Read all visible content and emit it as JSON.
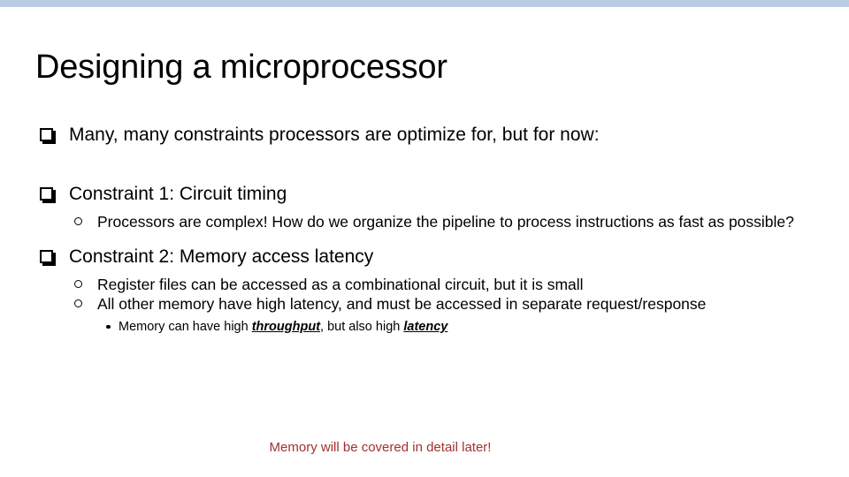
{
  "slide": {
    "title": "Designing a microprocessor",
    "top_bar_color": "#b8cce4",
    "background_color": "#ffffff",
    "text_color": "#000000",
    "accent_note_color": "#a33030"
  },
  "bullets": {
    "intro": "Many, many constraints processors are optimize for, but for now:",
    "constraint1": {
      "heading": "Constraint 1: Circuit timing",
      "sub1": "Processors are complex! How do we organize the pipeline to process instructions as fast as possible?"
    },
    "constraint2": {
      "heading": "Constraint 2: Memory access latency",
      "sub1": "Register files can be accessed as a combinational circuit, but it is small",
      "sub2": "All other memory have high latency, and must be accessed in separate request/response",
      "subsub1": {
        "part_a": "Memory can have high ",
        "term_a": "throughput",
        "part_b": ", but also high ",
        "term_b": "latency"
      }
    }
  },
  "footer_note": "Memory will be covered in detail later!",
  "icons": {
    "square_bullet": "shadowed-square-bullet",
    "circle_bullet": "hollow-circle-bullet",
    "dot_bullet": "filled-dot-bullet"
  }
}
